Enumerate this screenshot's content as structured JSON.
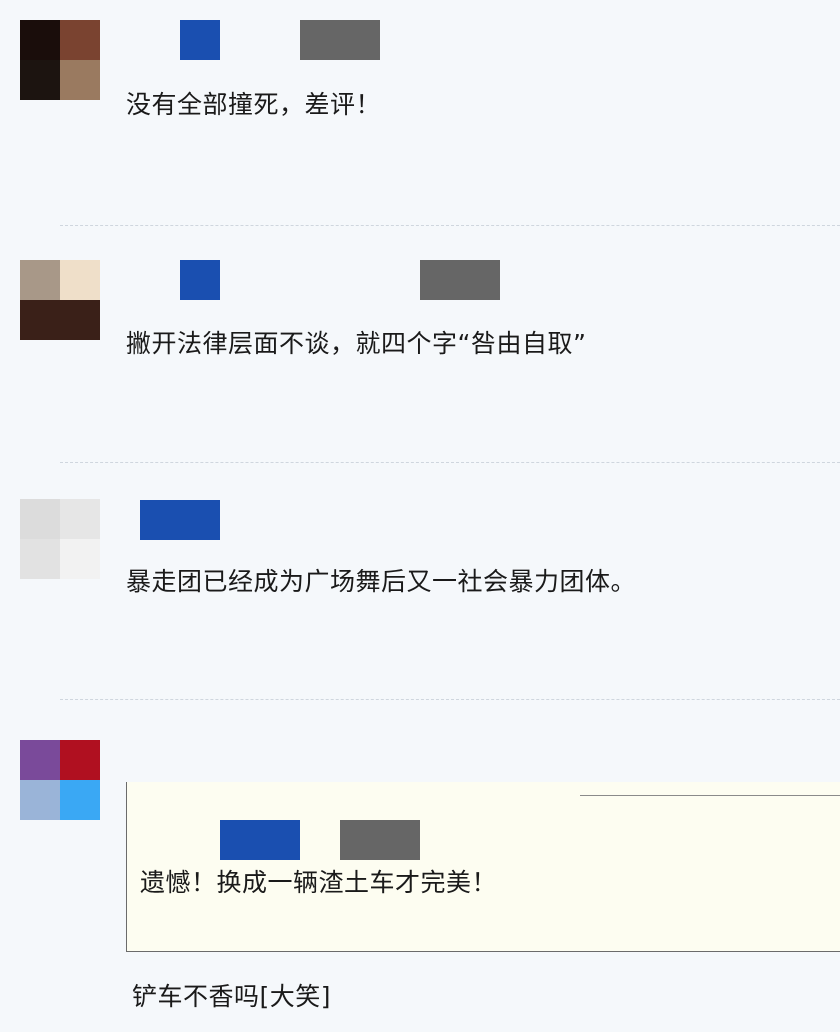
{
  "comments": [
    {
      "text": "没有全部撞死，差评！",
      "avatar_colors": [
        "#1a0d0b",
        "#7a4330",
        "#1c1410",
        "#9a7a60"
      ]
    },
    {
      "text": "撇开法律层面不谈，就四个字“咎由自取”",
      "avatar_colors": [
        "#a89888",
        "#efdfc9",
        "#3a2018",
        "#3a2018"
      ]
    },
    {
      "text": "暴走团已经成为广场舞后又一社会暴力团体。",
      "avatar_colors": [
        "#dcdcdc",
        "#e6e6e6",
        "#e2e2e2",
        "#f2f2f2"
      ]
    },
    {
      "quoted_text": "遗憾！换成一辆渣土车才完美！",
      "text": "铲车不香吗[大笑]",
      "avatar_colors": [
        "#7a4a9a",
        "#b01020",
        "#9ab4d8",
        "#3aa8f4"
      ]
    }
  ],
  "colors": {
    "redaction_blue": "#1a4fb0",
    "redaction_gray": "#666666",
    "background": "#f5f8fb",
    "quote_background": "#fdfdf1"
  }
}
